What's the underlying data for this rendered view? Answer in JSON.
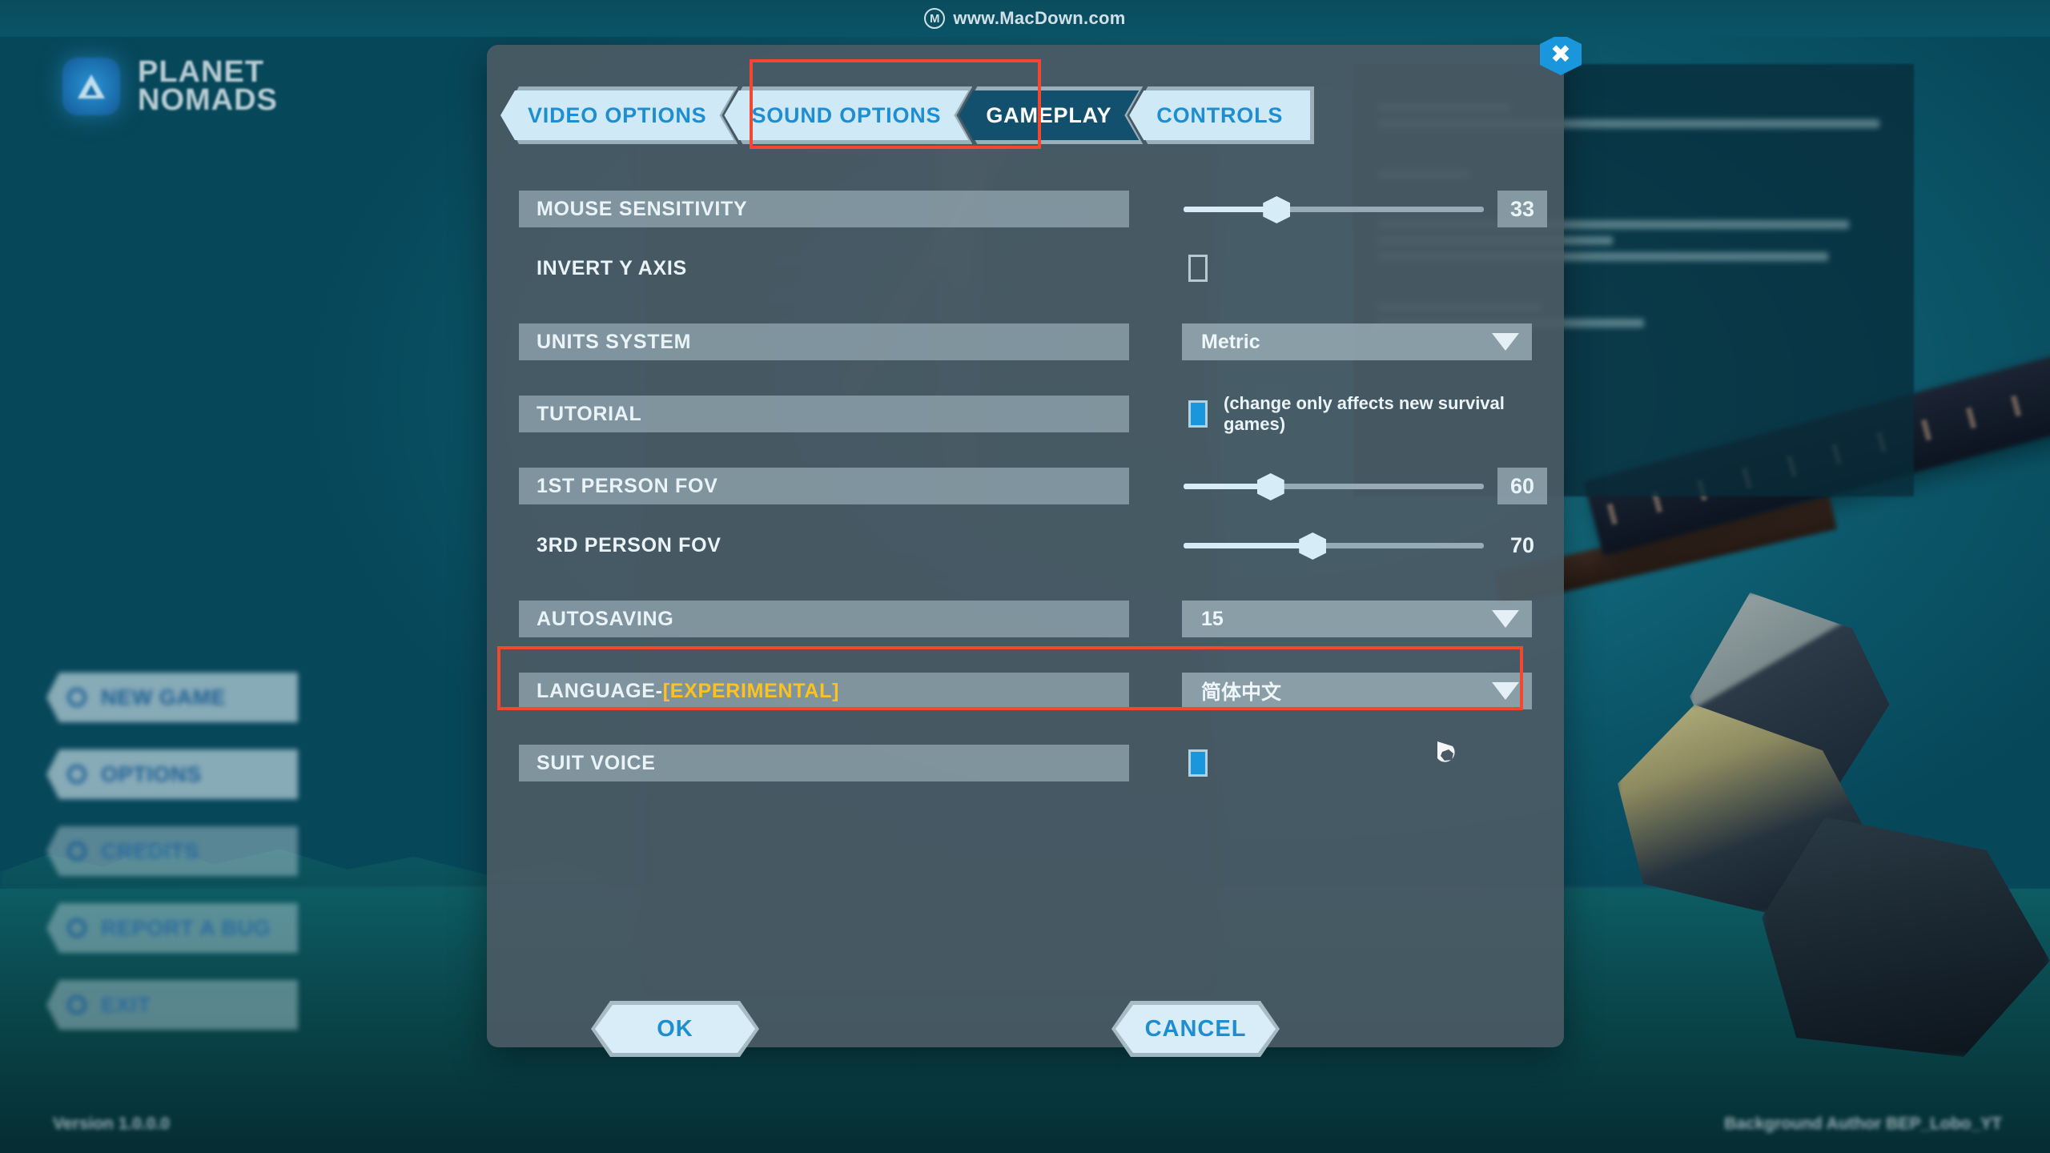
{
  "watermark": {
    "logo_glyph": "M",
    "text": "www.MacDown.com"
  },
  "game": {
    "logo_line1": "PLANET",
    "logo_line2": "NOMADS",
    "version": "Version 1.0.0.0",
    "background_author": "Background Author BEP_Lobo_YT"
  },
  "main_menu": {
    "items": [
      {
        "label": "NEW GAME"
      },
      {
        "label": "OPTIONS"
      },
      {
        "label": "CREDITS"
      },
      {
        "label": "REPORT A BUG"
      },
      {
        "label": "EXIT"
      }
    ]
  },
  "dialog": {
    "close_glyph": "✖",
    "tabs": [
      {
        "label": "VIDEO OPTIONS",
        "active": false
      },
      {
        "label": "SOUND OPTIONS",
        "active": false
      },
      {
        "label": "GAMEPLAY",
        "active": true
      },
      {
        "label": "CONTROLS",
        "active": false
      }
    ],
    "highlight_color": "#f4472f",
    "settings": {
      "mouse_sensitivity": {
        "label": "MOUSE SENSITIVITY",
        "value": "33",
        "percent": 31
      },
      "invert_y_axis": {
        "label": "INVERT Y AXIS",
        "checked": false
      },
      "units_system": {
        "label": "UNITS SYSTEM",
        "value": "Metric"
      },
      "tutorial": {
        "label": "TUTORIAL",
        "checked": true,
        "note": "(change only affects new survival games)"
      },
      "first_person_fov": {
        "label": "1ST PERSON FOV",
        "value": "60",
        "percent": 29
      },
      "third_person_fov": {
        "label": "3RD PERSON FOV",
        "value": "70",
        "percent": 43
      },
      "autosaving": {
        "label": "AUTOSAVING",
        "value": "15"
      },
      "language": {
        "label_main": "LANGUAGE",
        "label_sep": " - ",
        "label_tag": "[EXPERIMENTAL]",
        "value": "简体中文"
      },
      "suit_voice": {
        "label": "SUIT VOICE",
        "checked": true
      }
    },
    "buttons": {
      "ok": "OK",
      "cancel": "CANCEL"
    }
  },
  "colors": {
    "accent_blue": "#1996dc",
    "tab_text": "#1f8ed0",
    "active_tab_bg": "#12506d",
    "experimental_yellow": "#ffc21e",
    "highlight_red": "#f4472f",
    "dialog_bg": "#4a5a64"
  }
}
